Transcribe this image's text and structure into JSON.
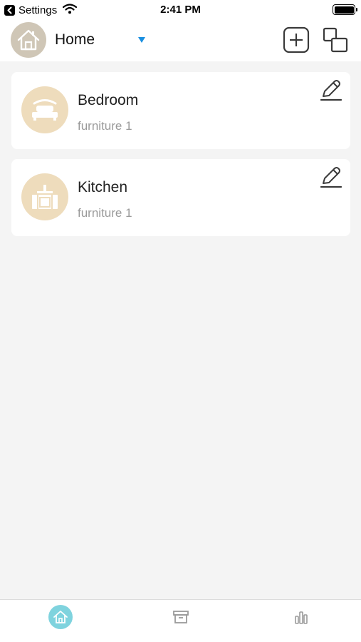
{
  "status_bar": {
    "back_app": "Settings",
    "time": "2:41 PM"
  },
  "header": {
    "home_label": "Home",
    "dropdown_color": "#1a8fe0"
  },
  "rooms": [
    {
      "name": "Bedroom",
      "count": "furniture 1",
      "icon": "bed-icon"
    },
    {
      "name": "Kitchen",
      "count": "furniture 1",
      "icon": "kitchen-icon"
    }
  ],
  "tab_bar": {
    "tabs": [
      {
        "icon": "home-tab-icon",
        "active": true
      },
      {
        "icon": "archive-tab-icon",
        "active": false
      },
      {
        "icon": "stats-tab-icon",
        "active": false
      }
    ],
    "active_color": "#7fd3de"
  },
  "colors": {
    "room_icon_bg": "#eedcbc",
    "home_avatar_bg": "#cfc6b6",
    "background": "#f4f4f4"
  }
}
